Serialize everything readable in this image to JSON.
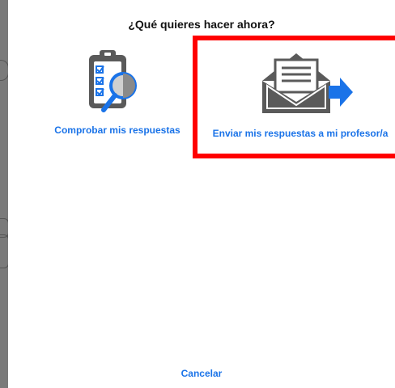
{
  "dialog": {
    "title": "¿Qué quieres hacer ahora?",
    "options": [
      {
        "label": "Comprobar mis respuestas",
        "icon": "clipboard-magnifier-icon",
        "selected": false
      },
      {
        "label": "Enviar mis respuestas a mi profesor/a",
        "icon": "envelope-send-icon",
        "selected": true
      }
    ],
    "cancel_label": "Cancelar"
  },
  "colors": {
    "link": "#1a73e8",
    "highlight": "#ff0000",
    "icon_gray": "#555555",
    "icon_blue": "#1a73e8"
  }
}
